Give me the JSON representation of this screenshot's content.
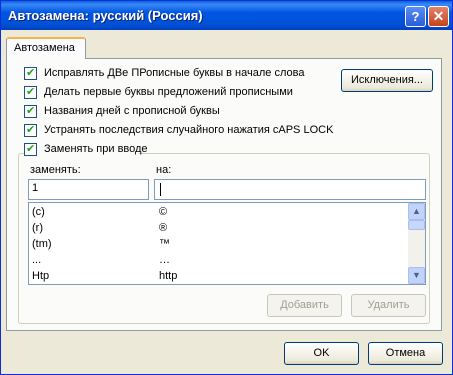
{
  "window": {
    "title": "Автозамена: русский (Россия)",
    "help_glyph": "?",
    "close_glyph": "✕"
  },
  "tab": {
    "label": "Автозамена"
  },
  "options": [
    {
      "label": "Исправлять ДВе ПРописные буквы в начале слова",
      "checked": true
    },
    {
      "label": "Делать первые буквы предложений прописными",
      "checked": true
    },
    {
      "label": "Названия дней с прописной буквы",
      "checked": true
    },
    {
      "label": "Устранять последствия случайного нажатия cAPS LOCK",
      "checked": true
    }
  ],
  "exceptions_button": "Исключения...",
  "replace_group": {
    "label": "Заменять при вводе",
    "checked": true
  },
  "replace_label": "заменять:",
  "with_label": "на:",
  "replace_value": "1",
  "with_value": "",
  "entries": [
    {
      "from": "(c)",
      "to": "©"
    },
    {
      "from": "(r)",
      "to": "®"
    },
    {
      "from": "(tm)",
      "to": "™"
    },
    {
      "from": "...",
      "to": "…"
    },
    {
      "from": "Htp",
      "to": "http"
    }
  ],
  "scroll_up_glyph": "▲",
  "scroll_down_glyph": "▼",
  "add_button": "Добавить",
  "delete_button": "Удалить",
  "ok_button": "OK",
  "cancel_button": "Отмена"
}
